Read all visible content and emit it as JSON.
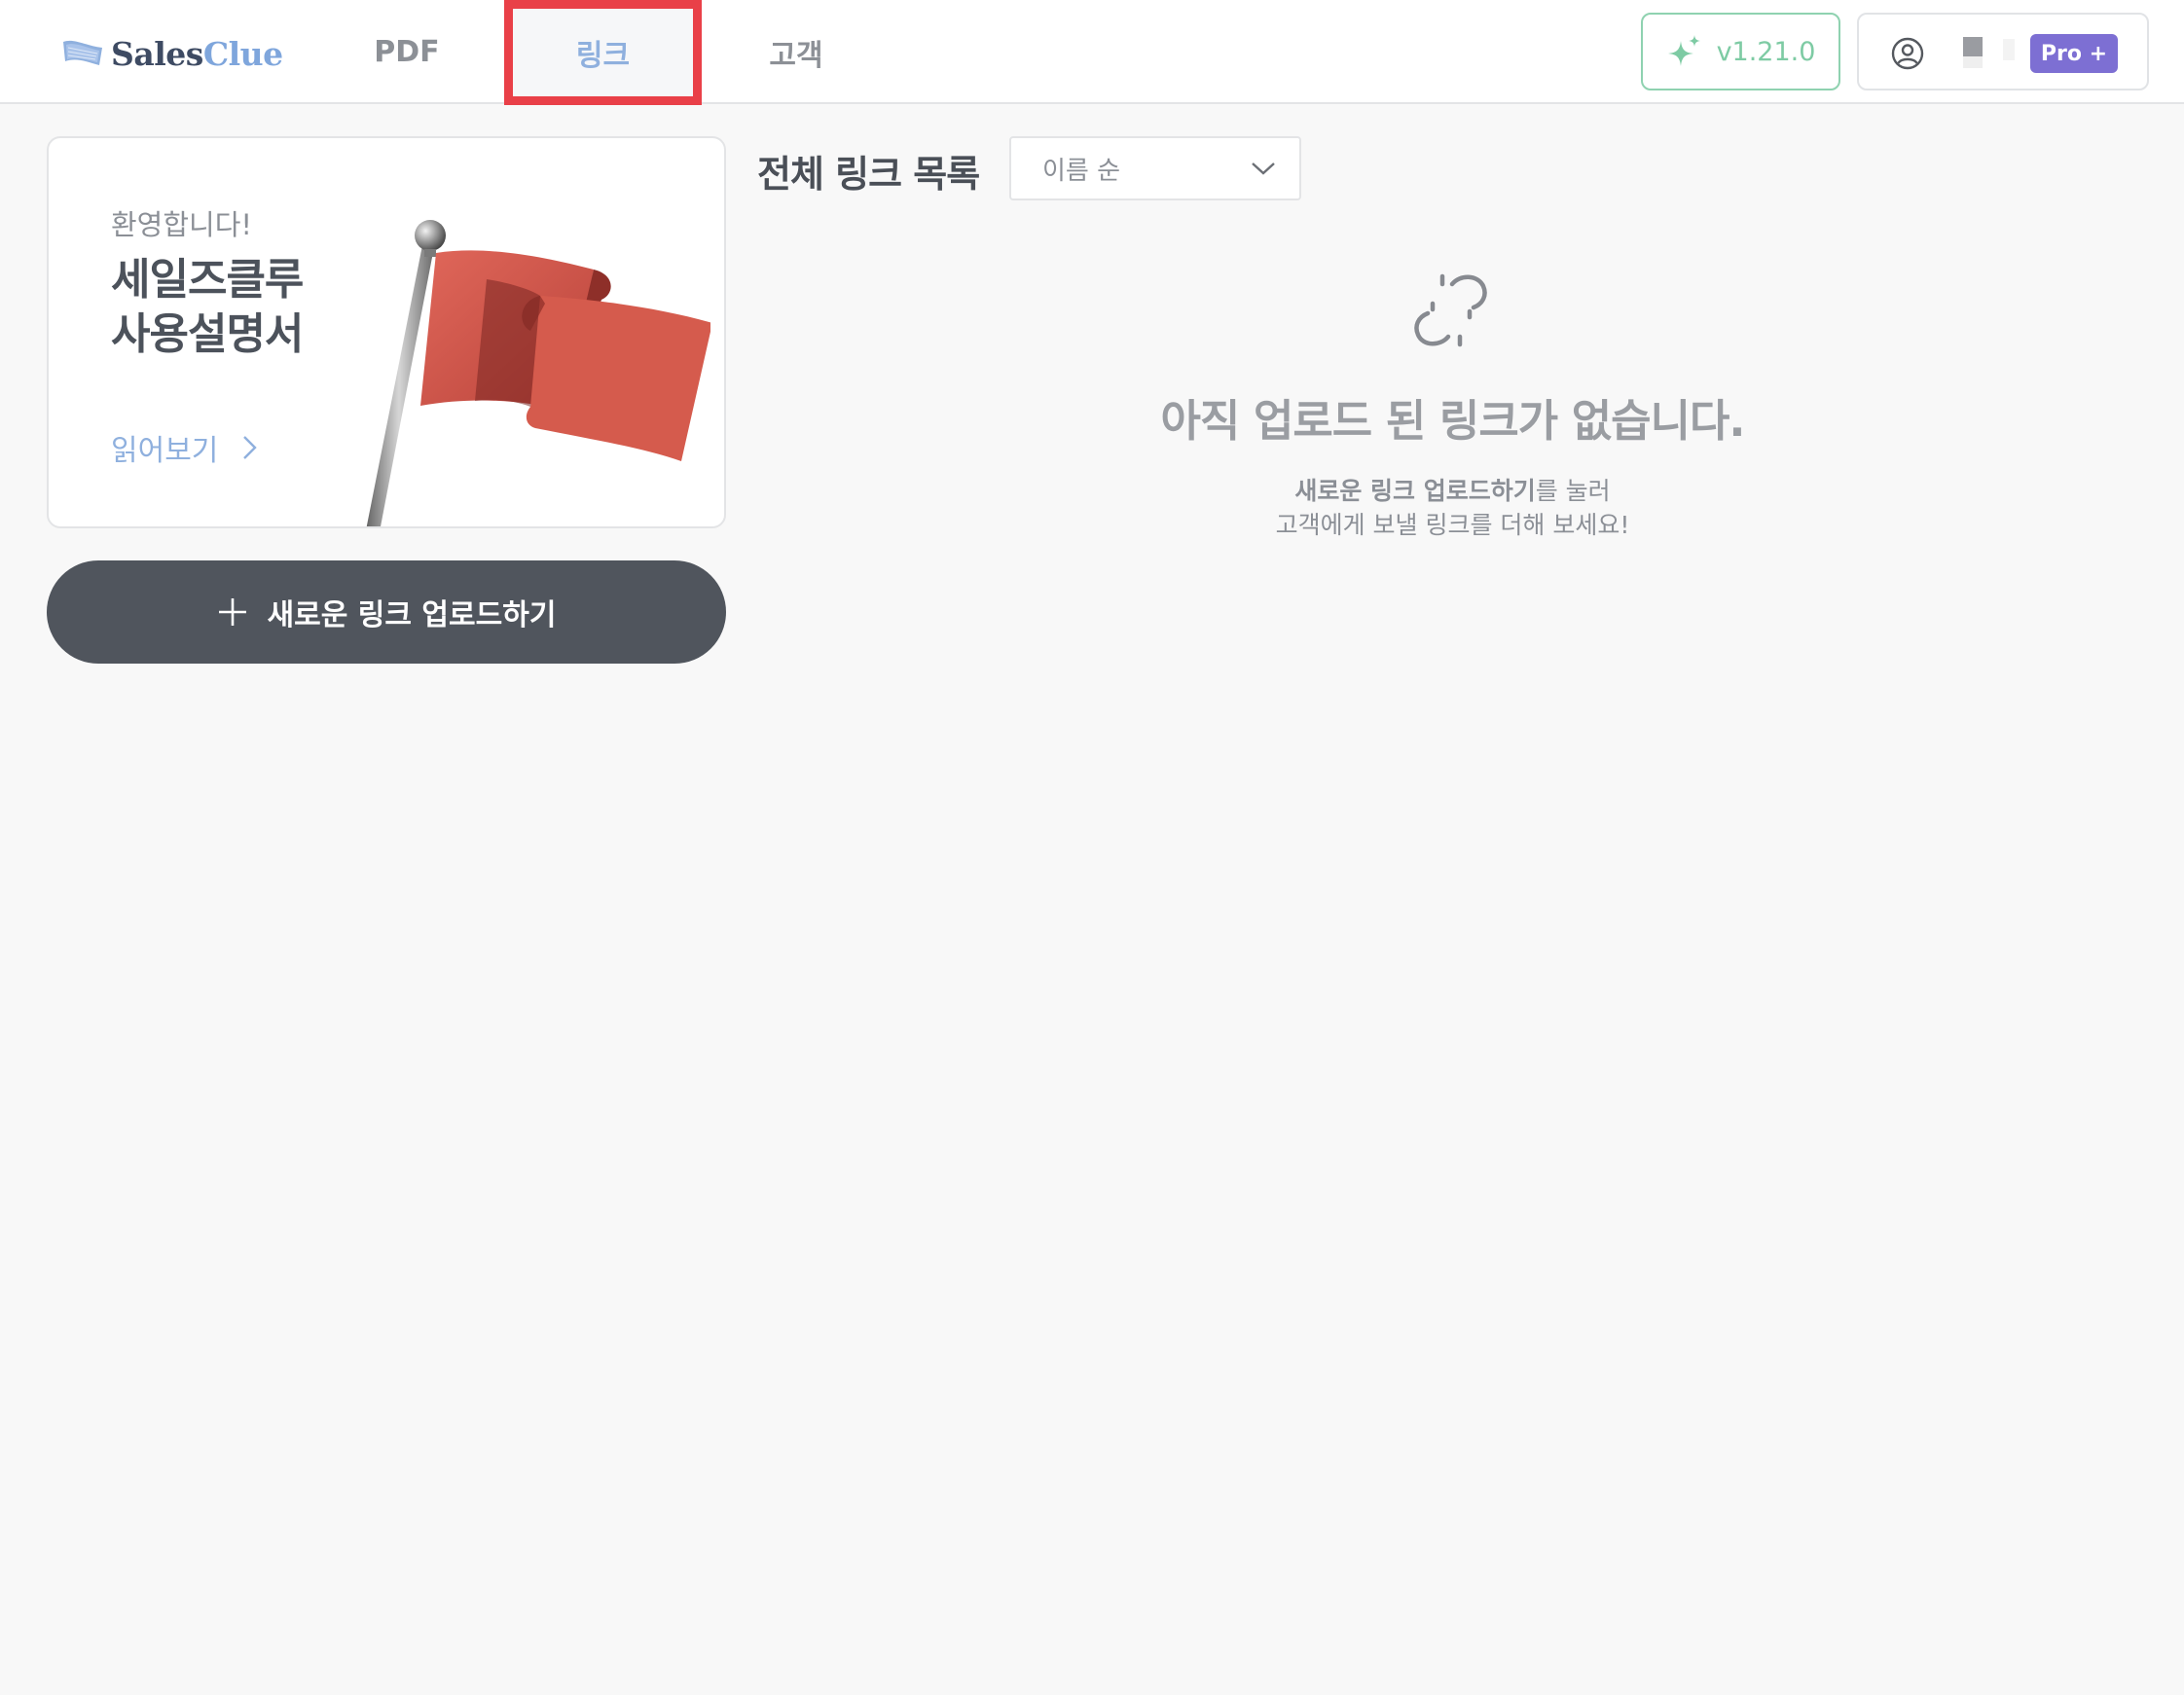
{
  "header": {
    "logo": {
      "part1": "Sales",
      "part2": "Clue"
    },
    "tabs": [
      {
        "label": "PDF",
        "active": false
      },
      {
        "label": "링크",
        "active": true
      },
      {
        "label": "고객",
        "active": false
      }
    ],
    "version_label": "v1.21.0",
    "plan_badge": "Pro +"
  },
  "guide_card": {
    "welcome": "환영합니다!",
    "title": "세일즈클루\n사용설명서",
    "read_more": "읽어보기"
  },
  "upload_button_label": "새로운 링크 업로드하기",
  "list": {
    "title": "전체 링크 목록",
    "sort_selected": "이름 순"
  },
  "empty_state": {
    "title": "아직 업로드 된 링크가 없습니다.",
    "desc_strong": "새로운 링크 업로드하기",
    "desc_rest1": "를 눌러",
    "desc_line2": "고객에게 보낼 링크를 더해 보세요!"
  },
  "colors": {
    "active_tab": "#8fb0de",
    "highlight_box": "#e94048",
    "version_green": "#7ecba4",
    "pro_badge": "#7d6fd3",
    "upload_button": "#50555d",
    "flag_red": "#d3574a"
  },
  "icons": {
    "version": "sparkle-icon",
    "account": "user-circle-icon",
    "read_more": "chevron-right-icon",
    "upload": "plus-icon",
    "sort": "chevron-down-icon",
    "empty": "broken-link-icon"
  }
}
